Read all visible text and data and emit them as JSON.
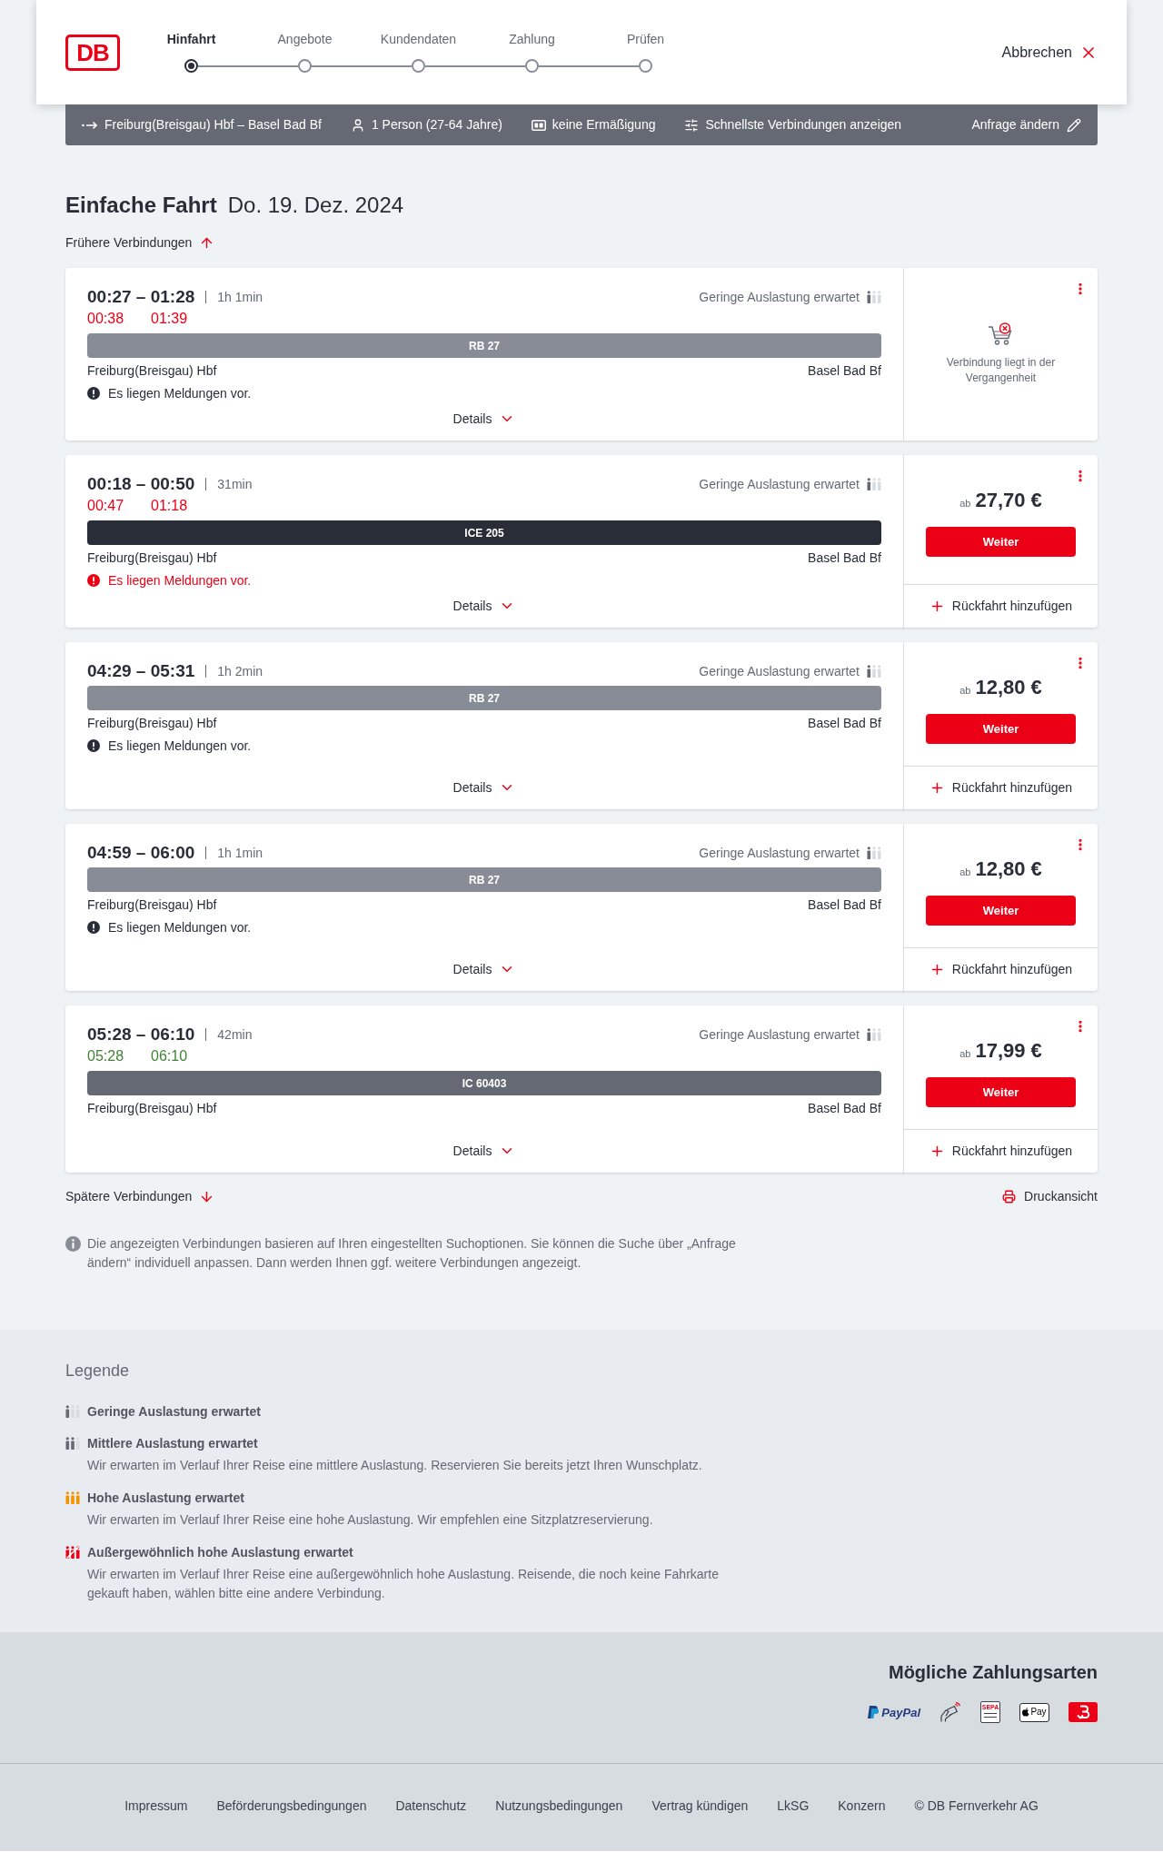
{
  "header": {
    "logo": "DB",
    "steps": [
      {
        "label": "Hinfahrt",
        "selected": true
      },
      {
        "label": "Angebote",
        "selected": false
      },
      {
        "label": "Kundendaten",
        "selected": false
      },
      {
        "label": "Zahlung",
        "selected": false
      },
      {
        "label": "Prüfen",
        "selected": false
      }
    ],
    "cancel": "Abbrechen"
  },
  "summary": {
    "items": [
      {
        "kind": "route",
        "text": "Freiburg(Breisgau) Hbf – Basel Bad Bf"
      },
      {
        "kind": "passengers",
        "text": "1 Person (27-64 Jahre)"
      },
      {
        "kind": "discount",
        "text": "keine Ermäßigung"
      },
      {
        "kind": "filter",
        "text": "Schnellste Verbindungen anzeigen"
      }
    ],
    "edit": "Anfrage ändern"
  },
  "title": {
    "trip_type": "Einfache Fahrt",
    "date": "Do. 19. Dez. 2024"
  },
  "earlier": "Frühere Verbindungen",
  "connections": [
    {
      "kind": "past",
      "times": "00:27 – 01:28",
      "duration": "1h 1min",
      "load": {
        "kind": "low",
        "label": "Geringe Auslastung erwartet"
      },
      "realtime": {
        "delayed": true,
        "departure": "00:38",
        "arrival": "01:39"
      },
      "train": {
        "kind": "regional",
        "label": "RB 27"
      },
      "from": "Freiburg(Breisgau) Hbf",
      "to": "Basel Bad Bf",
      "notice": {
        "critical": false,
        "text": "Es liegen Meldungen vor."
      },
      "details": "Details",
      "past_note": "Verbindung liegt in der Vergangenheit"
    },
    {
      "kind": "bookable",
      "times": "00:18 – 00:50",
      "duration": "31min",
      "load": {
        "kind": "low",
        "label": "Geringe Auslastung erwartet"
      },
      "realtime": {
        "delayed": true,
        "departure": "00:47",
        "arrival": "01:18"
      },
      "train": {
        "kind": "ice",
        "label": "ICE 205"
      },
      "from": "Freiburg(Breisgau) Hbf",
      "to": "Basel Bad Bf",
      "notice": {
        "critical": true,
        "text": "Es liegen Meldungen vor."
      },
      "details": "Details",
      "offer": {
        "prefix": "ab",
        "price": "27,70 €",
        "button": "Weiter",
        "return_trip": "Rückfahrt hinzufügen"
      }
    },
    {
      "kind": "bookable",
      "times": "04:29 – 05:31",
      "duration": "1h 2min",
      "load": {
        "kind": "low",
        "label": "Geringe Auslastung erwartet"
      },
      "train": {
        "kind": "regional",
        "label": "RB 27"
      },
      "from": "Freiburg(Breisgau) Hbf",
      "to": "Basel Bad Bf",
      "notice": {
        "critical": false,
        "text": "Es liegen Meldungen vor."
      },
      "details": "Details",
      "offer": {
        "prefix": "ab",
        "price": "12,80 €",
        "button": "Weiter",
        "return_trip": "Rückfahrt hinzufügen"
      }
    },
    {
      "kind": "bookable",
      "times": "04:59 – 06:00",
      "duration": "1h 1min",
      "load": {
        "kind": "low",
        "label": "Geringe Auslastung erwartet"
      },
      "train": {
        "kind": "regional",
        "label": "RB 27"
      },
      "from": "Freiburg(Breisgau) Hbf",
      "to": "Basel Bad Bf",
      "notice": {
        "critical": false,
        "text": "Es liegen Meldungen vor."
      },
      "details": "Details",
      "offer": {
        "prefix": "ab",
        "price": "12,80 €",
        "button": "Weiter",
        "return_trip": "Rückfahrt hinzufügen"
      }
    },
    {
      "kind": "bookable",
      "times": "05:28 – 06:10",
      "duration": "42min",
      "load": {
        "kind": "low",
        "label": "Geringe Auslastung erwartet"
      },
      "realtime": {
        "delayed": false,
        "departure": "05:28",
        "arrival": "06:10"
      },
      "train": {
        "kind": "ic",
        "label": "IC 60403"
      },
      "from": "Freiburg(Breisgau) Hbf",
      "to": "Basel Bad Bf",
      "details": "Details",
      "offer": {
        "prefix": "ab",
        "price": "17,99 €",
        "button": "Weiter",
        "return_trip": "Rückfahrt hinzufügen"
      }
    }
  ],
  "later": "Spätere Verbindungen",
  "print": "Druckansicht",
  "note": "Die angezeigten Verbindungen basieren auf Ihren eingestellten Suchoptionen. Sie können die Suche über „Anfrage ändern“ individuell anpassen. Dann werden Ihnen ggf. weitere Verbindungen angezeigt.",
  "legend": {
    "title": "Legende",
    "items": [
      {
        "kind": "low",
        "title": "Geringe Auslastung erwartet"
      },
      {
        "kind": "medium",
        "title": "Mittlere Auslastung erwartet",
        "text": "Wir erwarten im Verlauf Ihrer Reise eine mittlere Auslastung. Reservieren Sie bereits jetzt Ihren Wunschplatz."
      },
      {
        "kind": "high",
        "title": "Hohe Auslastung erwartet",
        "text": "Wir erwarten im Verlauf Ihrer Reise eine hohe Auslastung. Wir empfehlen eine Sitzplatzreservierung."
      },
      {
        "kind": "exceptional",
        "title": "Außergewöhnlich hohe Auslastung erwartet",
        "text": "Wir erwarten im Verlauf Ihrer Reise eine außergewöhnlich hohe Auslastung. Reisende, die noch keine Fahrkarte gekauft haben, wählen bitte eine andere Verbindung."
      }
    ]
  },
  "payment": {
    "title": "Mögliche Zahlungsarten",
    "methods": [
      {
        "kind": "paypal",
        "label": "PayPal"
      },
      {
        "kind": "contactless"
      },
      {
        "kind": "sepa",
        "label": "SEPA"
      },
      {
        "kind": "applepay",
        "label": "Pay"
      },
      {
        "kind": "tile"
      }
    ]
  },
  "footer": {
    "links": [
      "Impressum",
      "Beförderungsbedingungen",
      "Datenschutz",
      "Nutzungsbedingungen",
      "Vertrag kündigen",
      "LkSG",
      "Konzern"
    ],
    "copyright": "© DB Fernverkehr AG"
  }
}
